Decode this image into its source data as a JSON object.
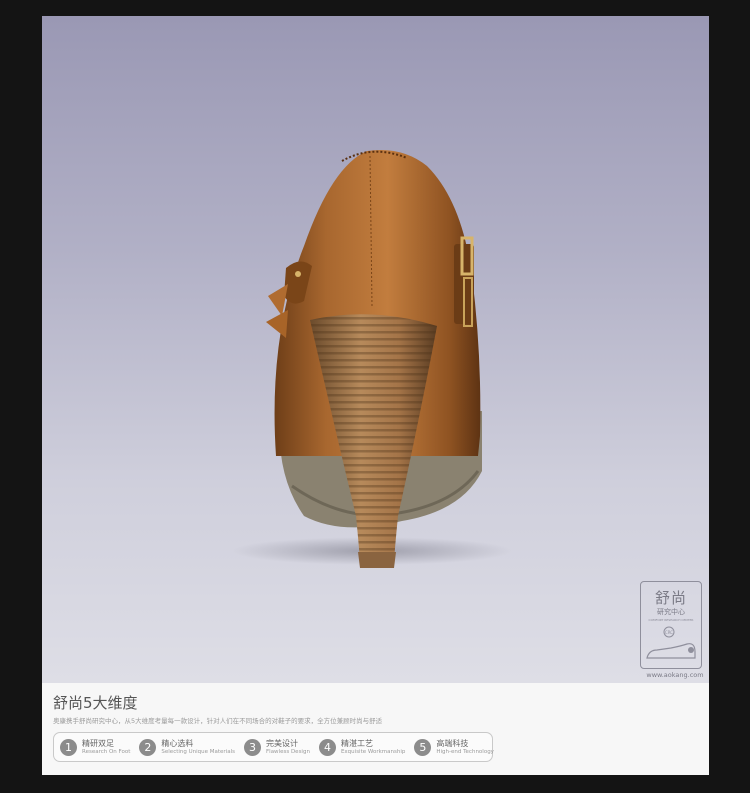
{
  "badge": {
    "title": "舒尚",
    "subtitle": "研究中心",
    "english": "COMFORT RESEARCH CENTER",
    "tag": "CRC"
  },
  "site": "www.aokang.com",
  "panel": {
    "title": "舒尚5大维度",
    "description": "奥康携手舒尚研究中心，从5大维度考量每一款设计，针对人们在不同场合的对鞋子的要求，全方位兼顾时尚与舒适",
    "dimensions": [
      {
        "num": "1",
        "zh": "精研双足",
        "en": "Research On Foot"
      },
      {
        "num": "2",
        "zh": "精心选料",
        "en": "Selecting Unique Materials"
      },
      {
        "num": "3",
        "zh": "完美设计",
        "en": "Flawless Design"
      },
      {
        "num": "4",
        "zh": "精湛工艺",
        "en": "Exquisite Workmanship"
      },
      {
        "num": "5",
        "zh": "高端科技",
        "en": "High-end Technology"
      }
    ]
  },
  "colors": {
    "leather": "#a0602a",
    "heel": "#a87a4e",
    "sole": "#8a8270",
    "background_top": "#9a98b4",
    "background_bottom": "#dedee6"
  }
}
